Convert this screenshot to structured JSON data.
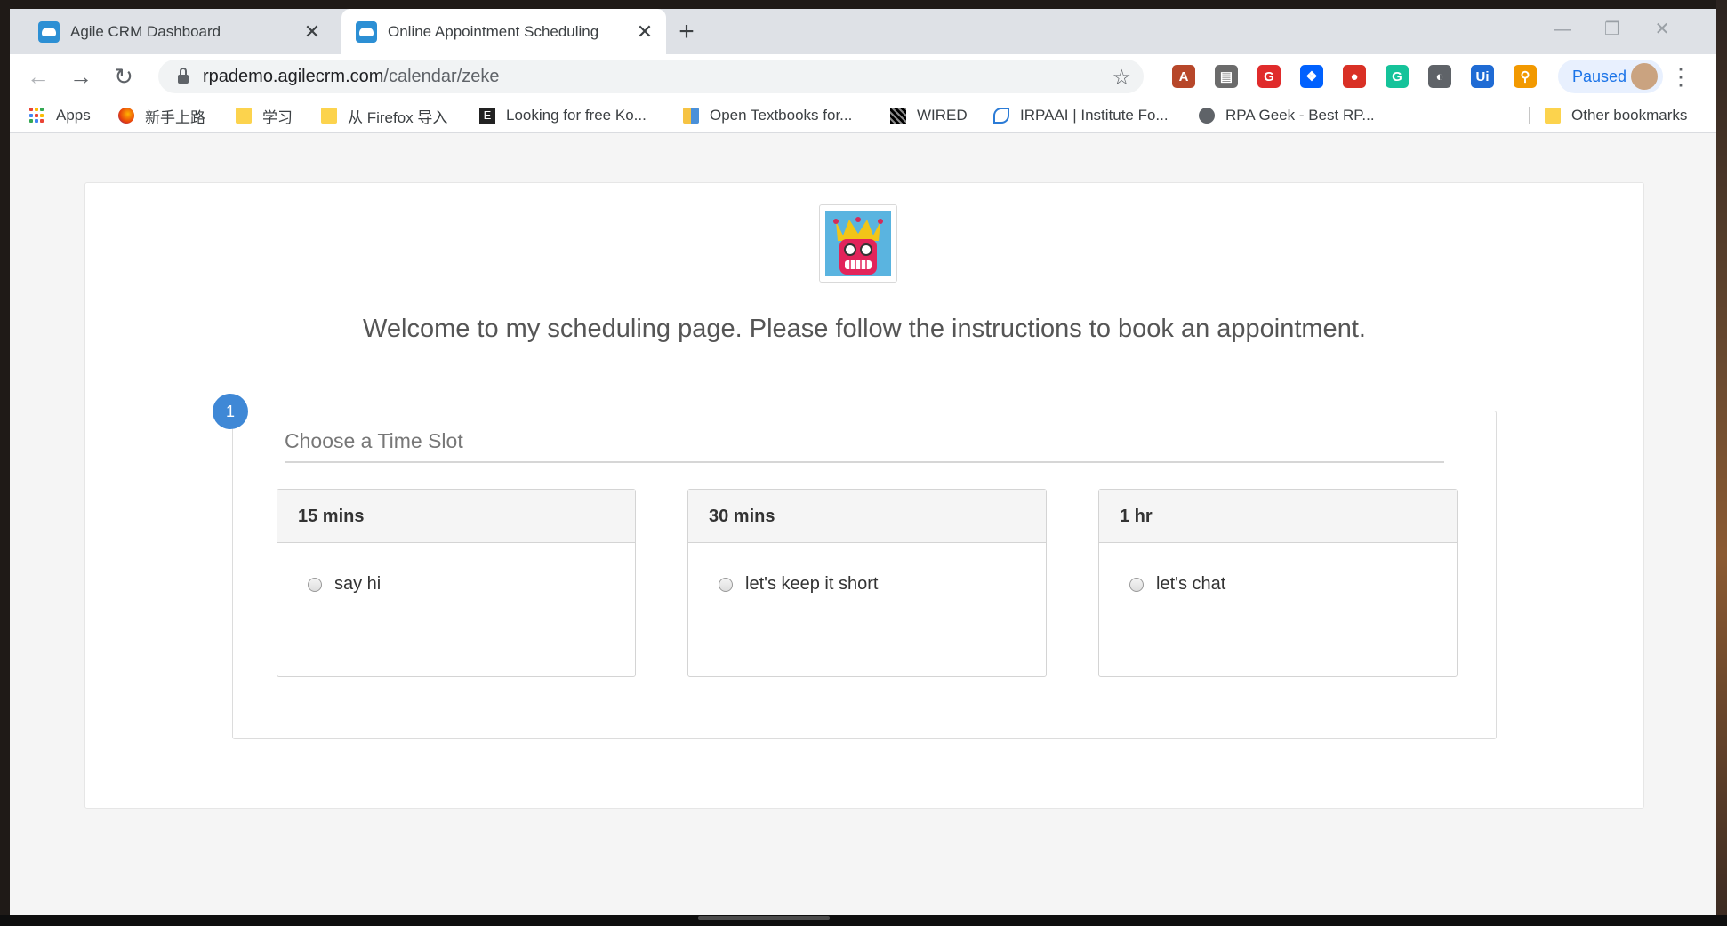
{
  "browser": {
    "tabs": [
      {
        "title": "Agile CRM Dashboard",
        "close": "✕"
      },
      {
        "title": "Online Appointment Scheduling",
        "close": "✕"
      }
    ],
    "new_tab": "+",
    "window_controls": {
      "minimize": "—",
      "restore": "❐",
      "close": "✕"
    },
    "url_host": "rpademo.agilecrm.com",
    "url_path": "/calendar/zeke",
    "profile_label": "Paused",
    "extensions": [
      {
        "icon": "pdf-icon",
        "glyph": "A",
        "color": "#b7472a"
      },
      {
        "icon": "document-icon",
        "glyph": "▤",
        "color": "#6b6b6b"
      },
      {
        "icon": "red-square-icon",
        "glyph": "G",
        "color": "#e02b2b"
      },
      {
        "icon": "dropbox-icon",
        "glyph": "❖",
        "color": "#0061fe"
      },
      {
        "icon": "record-icon",
        "glyph": "●",
        "color": "#d93025"
      },
      {
        "icon": "grammarly-icon",
        "glyph": "G",
        "color": "#15c39a"
      },
      {
        "icon": "circle-icon",
        "glyph": "◐",
        "color": "#5f6368"
      },
      {
        "icon": "uipath-icon",
        "glyph": "Ui",
        "color": "#1f6bd4"
      },
      {
        "icon": "headset-icon",
        "glyph": "⚲",
        "color": "#f29900"
      }
    ]
  },
  "bookmarks": [
    {
      "label": "Apps",
      "icon": "apps-icon"
    },
    {
      "label": "新手上路",
      "icon": "firefox-icon"
    },
    {
      "label": "学习",
      "icon": "folder-icon"
    },
    {
      "label": "从 Firefox 导入",
      "icon": "folder-icon"
    },
    {
      "label": "Looking for free Ko...",
      "icon": "e-icon"
    },
    {
      "label": "Open Textbooks for...",
      "icon": "textbook-icon"
    },
    {
      "label": "WIRED",
      "icon": "wired-icon"
    },
    {
      "label": "IRPAAI | Institute Fo...",
      "icon": "irpaai-icon"
    },
    {
      "label": "RPA Geek - Best RP...",
      "icon": "globe-icon"
    },
    {
      "label": "Other bookmarks",
      "icon": "folder-icon"
    }
  ],
  "page": {
    "welcome": "Welcome to my scheduling page. Please follow the instructions to book an appointment.",
    "step_number": "1",
    "step_title": "Choose a Time Slot",
    "slots": [
      {
        "duration": "15 mins",
        "option": "say hi"
      },
      {
        "duration": "30 mins",
        "option": "let's keep it short"
      },
      {
        "duration": "1 hr",
        "option": "let's chat"
      }
    ]
  }
}
